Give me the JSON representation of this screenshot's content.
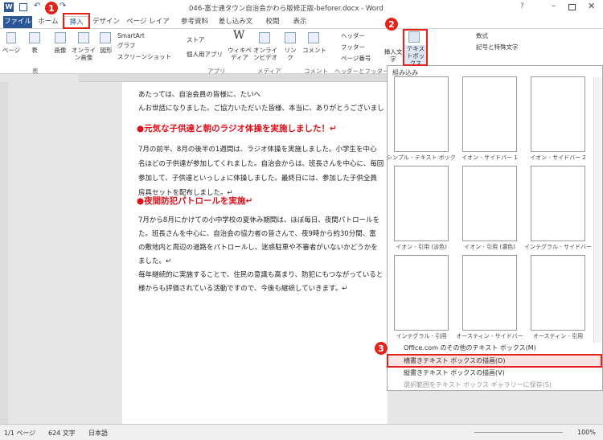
{
  "window": {
    "title": "046-富士通タウン自治会かわら版修正版-beforer.docx - Word"
  },
  "tabs": [
    "ファイル",
    "ホーム",
    "挿入",
    "デザイン",
    "ページ レイアウト",
    "参考資料",
    "差し込み文書",
    "校閲",
    "表示"
  ],
  "ribbon": {
    "page": "ページ",
    "table": "表",
    "image": "画像",
    "online_image": "オンライン画像",
    "shape": "図形",
    "smartart": "SmartArt",
    "graph": "グラフ",
    "screenshot": "スクリーンショット",
    "store": "ストア",
    "personal_apps": "個人用アプリ",
    "wikipedia": "ウィキペディア",
    "online_video": "オンラインビデオ",
    "link": "リンク",
    "comment": "コメント",
    "header": "ヘッダー",
    "footer": "フッター",
    "page_number": "ページ番号",
    "text_insert": "挿入文字",
    "textbox": "テキストボックス",
    "equation": "数式",
    "symbol": "記号と特殊文字",
    "group_table": "表",
    "group_apps": "アプリ",
    "group_media": "メディア",
    "group_comment": "コメント",
    "group_hf": "ヘッダーとフッター"
  },
  "doc": {
    "lines": [
      "あたっては、自治会員の皆様に、たいへ",
      "んお世話になりました。ご協力いただいた皆様、本当に、ありがとうございまし"
    ],
    "heading1": "●元気な子供達と朝のラジオ体操を実施しました！↵",
    "para1": [
      "7月の前半、8月の後半の1週間は、ラジオ体操を実施しました。小学生を中心",
      "名ほどの子供達が参加してくれました。自治会からは、班長さんを中心に、毎回",
      "参加して、子供達といっしょに体操しました。最終日には、参加した子供全員",
      "房具セットを配布しました。↵"
    ],
    "heading2": "●夜間防犯パトロールを実施↵",
    "para2": [
      "7月から8月にかけての小中学校の夏休み期間は、ほぼ毎日、夜間パトロールを",
      "た。班長さんを中心に、自治会の協力者の皆さんで、夜9時から約30分間、富",
      "の敷地内と周辺の道路をパトロールし、迷惑駐車や不審者がいないかどうかを",
      "ました。↵",
      "毎年継続的に実施することで、住民の意識も高まり、防犯にもつながっていると",
      "様からも評価されている活動ですので、今後も継続していきます。↵"
    ]
  },
  "panel": {
    "section": "組み込み",
    "thumbs": [
      "シンプル - テキスト ボックス",
      "イオン - サイドバー 1",
      "イオン - サイドバー 2",
      "イオン - 引用 (淡色)",
      "イオン - 引用 (濃色)",
      "インテグラル - サイドバー",
      "インテグラル - 引用",
      "オースティン - サイドバー",
      "オースティン - 引用"
    ],
    "menu": [
      "Office.com のその他のテキスト ボックス(M)",
      "横書きテキスト ボックスの描画(D)",
      "縦書きテキスト ボックスの描画(V)",
      "選択範囲をテキスト ボックス ギャラリーに保存(S)"
    ]
  },
  "badges": [
    "1",
    "2",
    "3"
  ],
  "status": {
    "page": "1/1 ページ",
    "words": "624 文字",
    "lang": "日本語",
    "zoom": "100%"
  }
}
